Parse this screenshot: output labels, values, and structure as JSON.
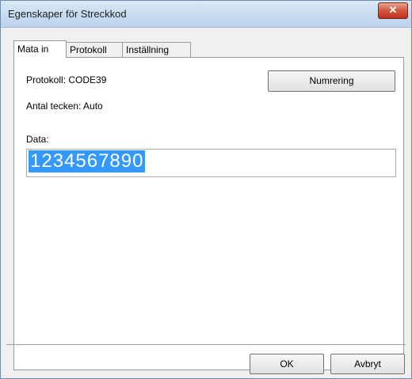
{
  "window": {
    "title": "Egenskaper för Streckkod",
    "close_symbol": "✕"
  },
  "tabs": [
    {
      "label": "Mata in",
      "active": true
    },
    {
      "label": "Protokoll",
      "active": false
    },
    {
      "label": "Inställning",
      "active": false
    }
  ],
  "panel": {
    "protocol_label": "Protokoll: CODE39",
    "length_label": "Antal tecken: Auto",
    "numbering_button": "Numrering",
    "data_label": "Data:",
    "data_value": "1234567890"
  },
  "footer": {
    "ok_button": "OK",
    "cancel_button": "Avbryt"
  },
  "colors": {
    "selection": "#3399ff",
    "close_button": "#c0321a"
  }
}
